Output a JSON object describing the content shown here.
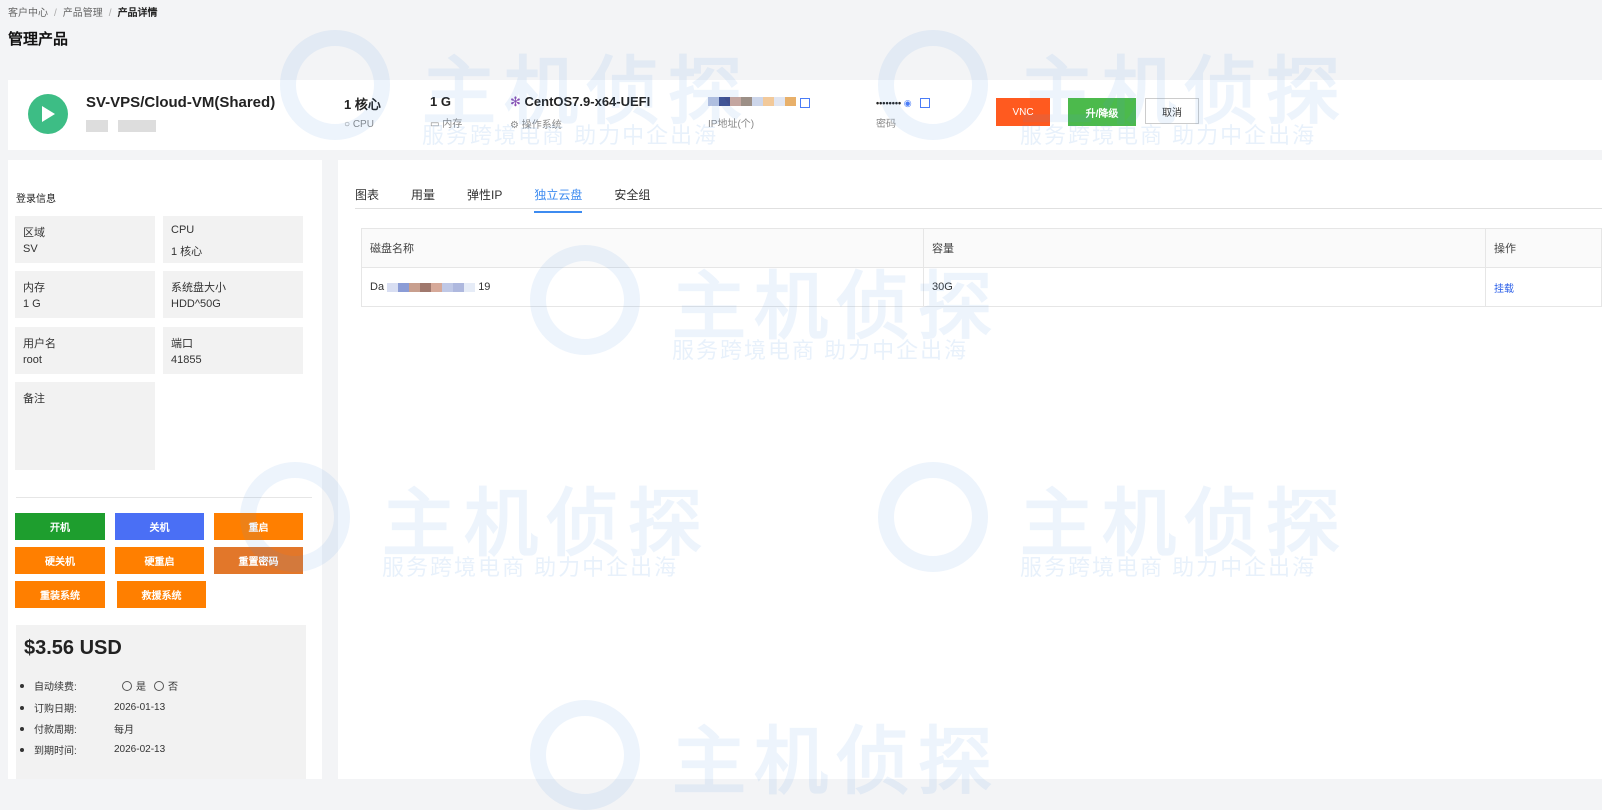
{
  "breadcrumb": [
    "客户中心",
    "产品管理",
    "产品详情"
  ],
  "page_title": "管理产品",
  "product": {
    "name": "SV-VPS/Cloud-VM(Shared)",
    "cpu": "1 核心",
    "cpu_label": "CPU",
    "memory": "1 G",
    "memory_label": "内存",
    "os": "CentOS7.9-x64-UEFI",
    "os_label": "操作系统",
    "ip_label": "IP地址(个)",
    "password": "••••••••",
    "password_label": "密码",
    "btn_vnc": "VNC",
    "btn_upgrade": "升/降级",
    "btn_cancel": "取消"
  },
  "login_info": {
    "title": "登录信息",
    "fields": [
      {
        "k": "区域",
        "v": "SV"
      },
      {
        "k": "CPU",
        "v": "1 核心"
      },
      {
        "k": "内存",
        "v": "1 G"
      },
      {
        "k": "系统盘大小",
        "v": "HDD^50G"
      },
      {
        "k": "用户名",
        "v": "root"
      },
      {
        "k": "端口",
        "v": "41855"
      },
      {
        "k": "备注",
        "v": ""
      }
    ]
  },
  "actions": [
    "开机",
    "关机",
    "重启",
    "硬关机",
    "硬重启",
    "重置密码",
    "重装系统",
    "救援系统"
  ],
  "colors": {
    "green": "#1e9e2e",
    "blue": "#4a6ff5",
    "orange": "#ff7f00",
    "vnc": "#ff5a1f",
    "upgrade": "#4cba4c",
    "accent": "#3d8bf0"
  },
  "billing": {
    "price": "$3.56 USD",
    "auto_renew_label": "自动续费:",
    "yes": "是",
    "no": "否",
    "order_date_label": "订购日期:",
    "order_date": "2026-01-13",
    "cycle_label": "付款周期:",
    "cycle": "每月",
    "expire_label": "到期时间:",
    "expire": "2026-02-13"
  },
  "tabs": [
    "图表",
    "用量",
    "弹性IP",
    "独立云盘",
    "安全组"
  ],
  "disk_table": {
    "headers": [
      "磁盘名称",
      "容量",
      "操作"
    ],
    "rows": [
      {
        "name_start": "Da",
        "name_end": "19",
        "size": "30G",
        "action": "挂载"
      }
    ]
  },
  "watermark": {
    "brand": "主机侦探",
    "slogan": "服务跨境电商  助力中企出海"
  }
}
